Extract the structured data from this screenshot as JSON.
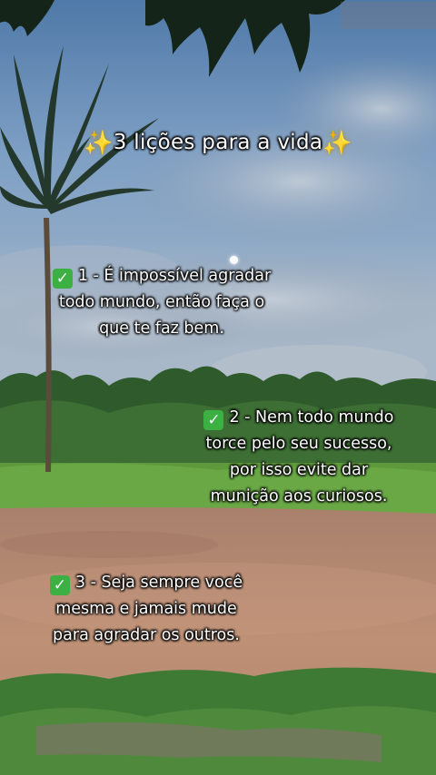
{
  "title": {
    "text": "3 lições para a vida",
    "icon_left": "sparkles-icon",
    "icon_right": "sparkles-icon"
  },
  "tips": [
    {
      "icon": "check-mark-button-icon",
      "lines": [
        "1 - É impossível agradar",
        "todo mundo, então faça o",
        "que te faz bem."
      ]
    },
    {
      "icon": "check-mark-button-icon",
      "lines": [
        "2 - Nem todo mundo",
        "torce pelo seu sucesso,",
        "por isso evite dar",
        "munição aos curiosos."
      ]
    },
    {
      "icon": "check-mark-button-icon",
      "lines": [
        "3 - Seja sempre você",
        "mesma e jamais mude",
        "para agradar os outros."
      ]
    }
  ],
  "colors": {
    "sky_top": "#5f87b5",
    "sky_mid": "#8fb0d0",
    "cloud": "#9aa6b6",
    "tree_line": "#2e5a2a",
    "grass": "#5f9a3e",
    "dirt": "#b78a70",
    "check_green": "#3cb043",
    "sparkle_gold": "#ffd64a"
  }
}
